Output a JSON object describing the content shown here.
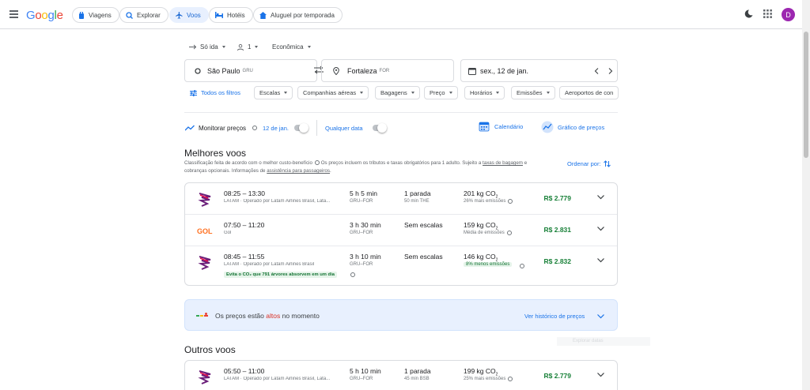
{
  "header": {
    "logo": [
      "G",
      "o",
      "o",
      "g",
      "l",
      "e"
    ],
    "tabs": [
      {
        "label": "Viagens",
        "icon": "suitcase-icon"
      },
      {
        "label": "Explorar",
        "icon": "explore-icon"
      },
      {
        "label": "Voos",
        "icon": "plane-icon",
        "active": true
      },
      {
        "label": "Hotéis",
        "icon": "bed-icon"
      },
      {
        "label": "Aluguel por temporada",
        "icon": "house-icon"
      }
    ],
    "avatar_letter": "D"
  },
  "search": {
    "trip_type": "Só ida",
    "passengers": "1",
    "cabin": "Econômica",
    "origin": "São Paulo",
    "origin_code": "GRU",
    "destination": "Fortaleza",
    "destination_code": "FOR",
    "date": "sex., 12 de jan."
  },
  "filters": {
    "all": "Todos os filtros",
    "chips": [
      "Escalas",
      "Companhias aéreas",
      "Bagagens",
      "Preço",
      "Horários",
      "Emissões",
      "Aeroportos de con"
    ]
  },
  "tracking": {
    "label": "Monitorar preços",
    "date": "12 de jan.",
    "any_date": "Qualquer data",
    "calendar": "Calendário",
    "price_graph": "Gráfico de preços"
  },
  "best": {
    "title": "Melhores voos",
    "desc_1": "Classificação feita de acordo com o melhor custo-benefício",
    "desc_2": "Os preços incluem os tributos e taxas obrigatórios para 1 adulto. Sujeito a",
    "desc_link_1": "taxas de bagagem",
    "desc_3": "e cobranças opcionais. Informações de",
    "desc_link_2": "assistência para passageiros",
    "desc_end": ".",
    "order_label": "Ordenar por:",
    "flights": [
      {
        "airline": "LATAM",
        "times": "08:25 – 13:30",
        "operator": "LATAM · Operado por Latam Airlines Brasil, Lata...",
        "duration": "5 h 5 min",
        "route": "GRU–FOR",
        "stops": "1 parada",
        "stop_info": "50 min THE",
        "co2": "201 kg CO",
        "co2_note": "26% mais emissões",
        "price": "R$ 2.779"
      },
      {
        "airline": "GOL",
        "times": "07:50 – 11:20",
        "operator": "Gol",
        "duration": "3 h 30 min",
        "route": "GRU–FOR",
        "stops": "Sem escalas",
        "stop_info": "",
        "co2": "159 kg CO",
        "co2_note": "Média de emissões",
        "price": "R$ 2.831"
      },
      {
        "airline": "LATAM",
        "times": "08:45 – 11:55",
        "operator": "LATAM · Operado por Latam Airlines Brasil",
        "duration": "3 h 10 min",
        "route": "GRU–FOR",
        "stops": "Sem escalas",
        "stop_info": "",
        "co2": "146 kg CO",
        "co2_note": "8% menos emissões",
        "price": "R$ 2.832",
        "badge": "Evita o CO₂ que 791 árvores absorvem em um dia"
      }
    ]
  },
  "banner": {
    "text_1": "Os preços estão",
    "text_highlight": "altos",
    "text_2": "no momento",
    "history": "Ver histórico de preços"
  },
  "others": {
    "title": "Outros voos",
    "ghost": "Explorar datas",
    "flights": [
      {
        "airline": "LATAM",
        "times": "05:50 – 11:00",
        "operator": "LATAM · Operado por Latam Airlines Brasil, Lata...",
        "duration": "5 h 10 min",
        "route": "GRU–FOR",
        "stops": "1 parada",
        "stop_info": "45 min BSB",
        "co2": "199 kg CO",
        "co2_note": "25% mais emissões",
        "price": "R$ 2.779"
      }
    ]
  },
  "colors": {
    "accent": "#1a73e8",
    "price_green": "#188038",
    "avatar": "#9c27b0"
  }
}
